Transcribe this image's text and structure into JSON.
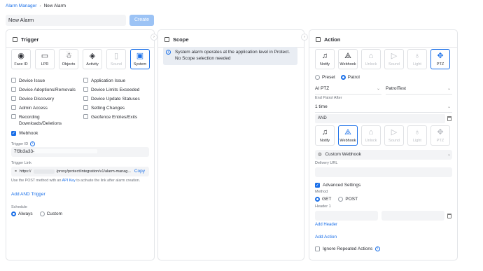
{
  "breadcrumb": {
    "root": "Alarm Manager",
    "separator": "›",
    "current": "New Alarm"
  },
  "alarm_name": {
    "value": "New Alarm"
  },
  "create_label": "Create",
  "trigger": {
    "title": "Trigger",
    "tiles": [
      {
        "label": "Face ID",
        "icon": "face-id-icon",
        "glyph": "◉",
        "state": "normal"
      },
      {
        "label": "LPR",
        "icon": "license-plate-icon",
        "glyph": "▭",
        "state": "normal"
      },
      {
        "label": "Objects",
        "icon": "person-icon",
        "glyph": "☃",
        "state": "normal"
      },
      {
        "label": "Activity",
        "icon": "motion-icon",
        "glyph": "◈",
        "state": "normal"
      },
      {
        "label": "Sound",
        "icon": "sound-icon",
        "glyph": "▯",
        "state": "disabled"
      },
      {
        "label": "System",
        "icon": "system-icon",
        "glyph": "▣",
        "state": "selected"
      }
    ],
    "options_left": [
      {
        "label": "Device Issue",
        "checked": false
      },
      {
        "label": "Device Adoptions/Removals",
        "checked": false
      },
      {
        "label": "Device Discovery",
        "checked": false
      },
      {
        "label": "Admin Access",
        "checked": false
      },
      {
        "label": "Recording Downloads/Deletions",
        "checked": false
      }
    ],
    "options_right": [
      {
        "label": "Application Issue",
        "checked": false
      },
      {
        "label": "Device Limits Exceeded",
        "checked": false
      },
      {
        "label": "Device Update Statuses",
        "checked": false
      },
      {
        "label": "Setting Changes",
        "checked": false
      },
      {
        "label": "Geofence Entries/Exits",
        "checked": false
      }
    ],
    "webhook": {
      "label": "Webhook",
      "checked": true
    },
    "trigger_id_label": "Trigger ID",
    "trigger_id_value": "7f3b3a33-",
    "trigger_link_label": "Trigger Link",
    "trigger_link_prefix": "https://",
    "trigger_link_suffix": "/proxy/protect/integration/v1/alarm-manag...",
    "copy_label": "Copy",
    "hint_before": "Use the POST method with an ",
    "hint_link": "API Key",
    "hint_after": " to activate the link after alarm creation.",
    "add_and_trigger": "Add AND Trigger",
    "schedule_label": "Schedule",
    "schedule_always": "Always",
    "schedule_custom": "Custom",
    "schedule_selected": "Always"
  },
  "scope": {
    "title": "Scope",
    "info": "System alarm operates at the application level in Protect. No Scope selection needed"
  },
  "action": {
    "title": "Action",
    "tiles": [
      {
        "label": "Notify",
        "icon": "bell-icon",
        "glyph": "♫",
        "state": "normal"
      },
      {
        "label": "Webhook",
        "icon": "webhook-icon",
        "glyph": "⟁",
        "state": "normal"
      },
      {
        "label": "Unlock",
        "icon": "unlock-icon",
        "glyph": "⌂",
        "state": "disabled"
      },
      {
        "label": "Sound",
        "icon": "speaker-icon",
        "glyph": "▷",
        "state": "disabled"
      },
      {
        "label": "Light",
        "icon": "bulb-icon",
        "glyph": "♁",
        "state": "disabled"
      },
      {
        "label": "PTZ",
        "icon": "ptz-icon",
        "glyph": "✥",
        "state": "selected"
      }
    ],
    "preset_label": "Preset",
    "patrol_label": "Patrol",
    "mode_selected": "Patrol",
    "camera_select": "AI PTZ",
    "patrol_select": "PatrolTest",
    "end_patrol_label": "End Patrol After",
    "end_patrol_value": "1 time",
    "and_label": "AND",
    "tiles2": [
      {
        "label": "Notify",
        "icon": "bell-icon",
        "glyph": "♫",
        "state": "normal"
      },
      {
        "label": "Webhook",
        "icon": "webhook-icon",
        "glyph": "⟁",
        "state": "selected"
      },
      {
        "label": "Unlock",
        "icon": "unlock-icon",
        "glyph": "⌂",
        "state": "disabled"
      },
      {
        "label": "Sound",
        "icon": "speaker-icon",
        "glyph": "▷",
        "state": "disabled"
      },
      {
        "label": "Light",
        "icon": "bulb-icon",
        "glyph": "♁",
        "state": "disabled"
      },
      {
        "label": "PTZ",
        "icon": "ptz-icon",
        "glyph": "✥",
        "state": "disabled"
      }
    ],
    "webhook_type": "Custom Webhook",
    "delivery_url_label": "Delivery URL",
    "delivery_url_value": "",
    "advanced_label": "Advanced Settings",
    "advanced_checked": true,
    "method_label": "Method",
    "method_get": "GET",
    "method_post": "POST",
    "method_selected": "GET",
    "header_label": "Header 1",
    "add_header": "Add Header",
    "add_action": "Add Action",
    "ignore_label": "Ignore Repeated Actions"
  },
  "colors": {
    "accent": "#1a6fe8",
    "create_disabled": "#9cc3f5"
  }
}
